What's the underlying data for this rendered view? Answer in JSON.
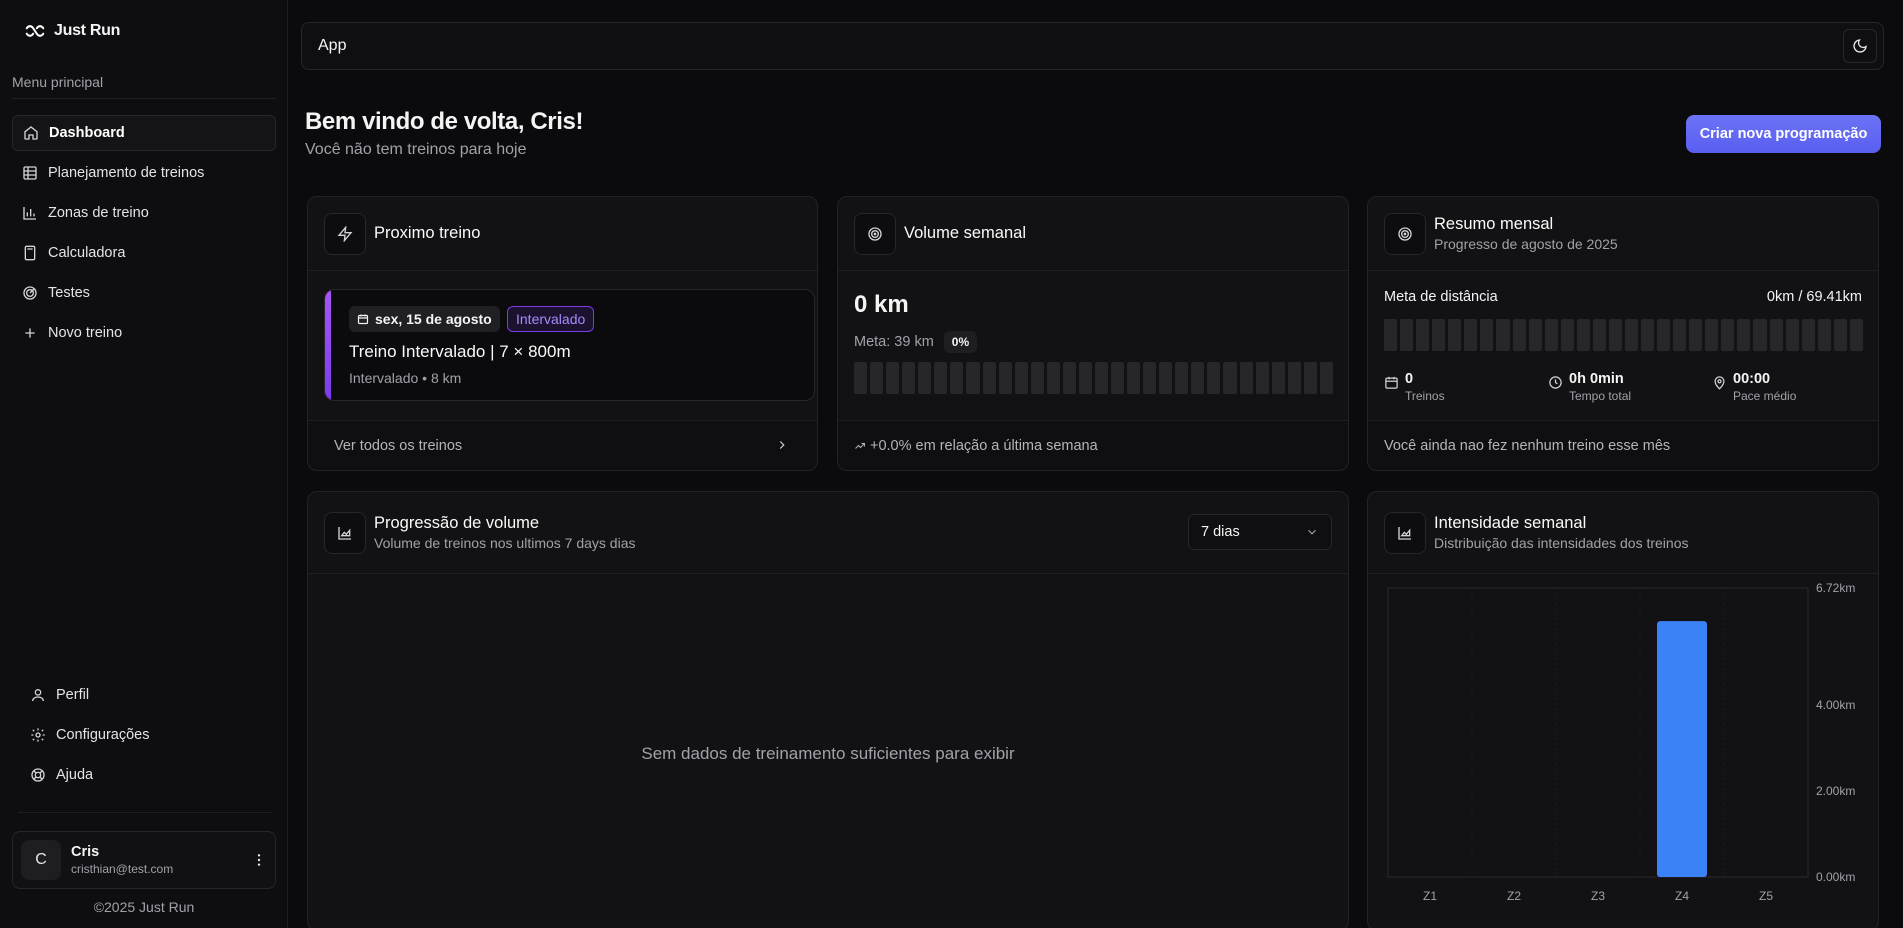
{
  "brand": {
    "name": "Just Run"
  },
  "sidebar": {
    "menu_title": "Menu principal",
    "items": [
      {
        "label": "Dashboard",
        "icon": "home-icon",
        "active": true
      },
      {
        "label": "Planejamento de treinos",
        "icon": "table-icon"
      },
      {
        "label": "Zonas de treino",
        "icon": "bar-chart-icon"
      },
      {
        "label": "Calculadora",
        "icon": "calculator-icon"
      },
      {
        "label": "Testes",
        "icon": "radar-icon"
      },
      {
        "label": "Novo treino",
        "icon": "plus-icon"
      }
    ],
    "bottom_items": [
      {
        "label": "Perfil",
        "icon": "user-icon"
      },
      {
        "label": "Configurações",
        "icon": "gear-icon"
      },
      {
        "label": "Ajuda",
        "icon": "lifebuoy-icon"
      }
    ],
    "user": {
      "initial": "C",
      "name": "Cris",
      "email": "cristhian@test.com"
    },
    "copyright": "©2025 Just Run"
  },
  "topbar": {
    "title": "App"
  },
  "header": {
    "welcome": "Bem vindo de volta, Cris!",
    "subtitle": "Você não tem treinos para hoje",
    "cta_label": "Criar nova programação"
  },
  "next_workout": {
    "title": "Proximo treino",
    "date": "sex, 15 de agosto",
    "type_badge": "Intervalado",
    "workout_title": "Treino Intervalado | 7 × 800m",
    "meta": "Intervalado • 8 km",
    "footer": "Ver todos os treinos"
  },
  "weekly_volume": {
    "title": "Volume semanal",
    "value": "0 km",
    "goal": "Meta: 39 km",
    "percent": "0%",
    "progress": 0,
    "trend": "+0.0% em relação a última semana"
  },
  "monthly_summary": {
    "title": "Resumo mensal",
    "subtitle": "Progresso de agosto de 2025",
    "distance_label": "Meta de distância",
    "distance_value": "0km / 69.41km",
    "progress": 0,
    "stats": [
      {
        "value": "0",
        "label": "Treinos",
        "icon": "calendar-icon"
      },
      {
        "value": "0h 0min",
        "label": "Tempo total",
        "icon": "clock-icon"
      },
      {
        "value": "00:00",
        "label": "Pace médio",
        "icon": "map-pin-icon"
      }
    ],
    "footer": "Você ainda nao fez nenhum treino esse mês"
  },
  "volume_progression": {
    "title": "Progressão de volume",
    "subtitle": "Volume de treinos nos ultimos 7 days dias",
    "select_value": "7 dias",
    "empty_message": "Sem dados de treinamento suficientes para exibir"
  },
  "weekly_intensity": {
    "title": "Intensidade semanal",
    "subtitle": "Distribuição das intensidades dos treinos"
  },
  "chart_data": {
    "type": "bar",
    "categories": [
      "Z1",
      "Z2",
      "Z3",
      "Z4",
      "Z5"
    ],
    "values": [
      0,
      0,
      0,
      5.95,
      0
    ],
    "ytick_labels": [
      "6.72km",
      "4.00km",
      "2.00km",
      "0.00km"
    ],
    "ytick_values": [
      6.72,
      4,
      2,
      0
    ],
    "ylim": [
      0,
      6.72
    ],
    "bar_color": "#3b82f6",
    "grid": true,
    "y_axis_position": "right"
  }
}
